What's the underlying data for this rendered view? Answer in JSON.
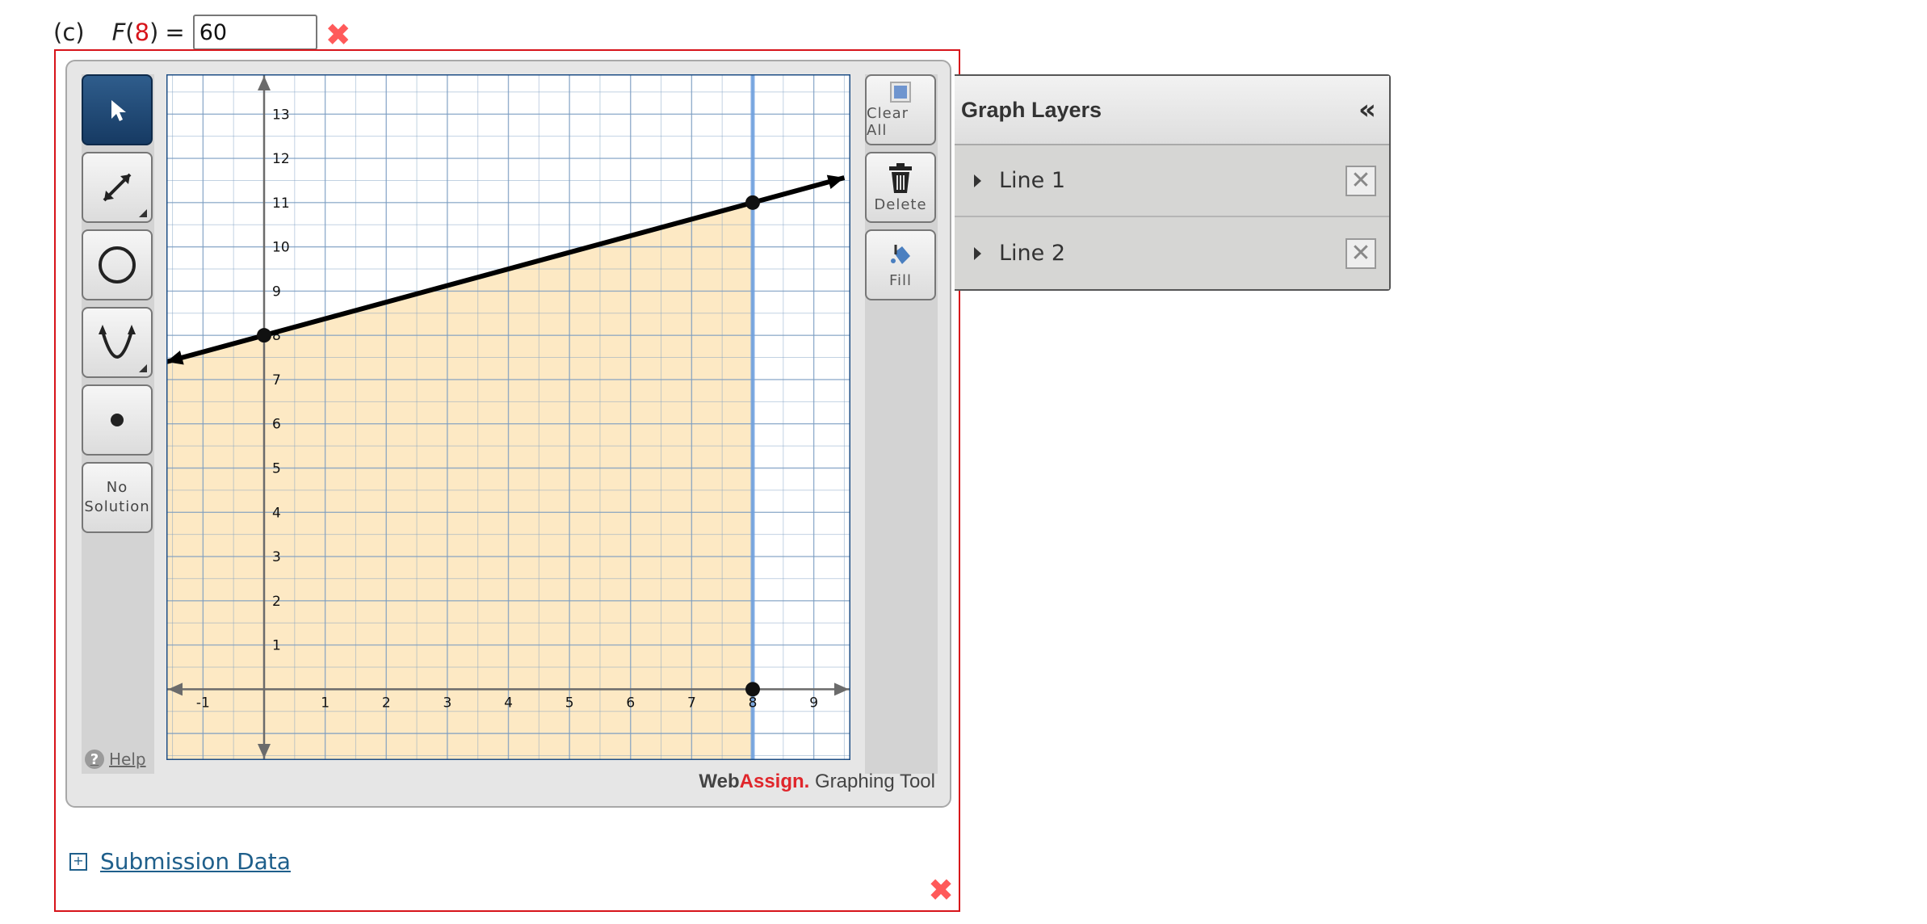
{
  "question": {
    "part_label": "(c)",
    "function_name": "F",
    "argument": "8",
    "equals": "=",
    "answer_value": "60",
    "incorrect_mark": "✖"
  },
  "tools": {
    "no_solution_line1": "No",
    "no_solution_line2": "Solution",
    "help_label": "Help",
    "help_icon": "?",
    "clear_all_label": "Clear All",
    "delete_label": "Delete",
    "fill_label": "Fill"
  },
  "brand": {
    "web": "Web",
    "assign": "Assign.",
    "rest": " Graphing Tool"
  },
  "layers": {
    "title": "Graph Layers",
    "collapse_icon": "«",
    "items": [
      {
        "label": "Line 1",
        "delete_icon": "✕"
      },
      {
        "label": "Line 2",
        "delete_icon": "✕"
      }
    ]
  },
  "submission": {
    "toggle": "+",
    "label": "Submission Data"
  },
  "frame_mark": "✖",
  "chart_data": {
    "type": "line",
    "x_ticks": [
      -1,
      1,
      2,
      3,
      4,
      5,
      6,
      7,
      8,
      9
    ],
    "y_ticks": [
      1,
      2,
      3,
      4,
      5,
      6,
      7,
      8,
      9,
      10,
      11,
      12,
      13
    ],
    "xlim": [
      -1.6,
      9.6
    ],
    "ylim": [
      -1.6,
      13.9
    ],
    "grid": true,
    "series": [
      {
        "kind": "line",
        "points": [
          [
            0,
            8
          ],
          [
            8,
            11
          ]
        ],
        "color": "#000000"
      },
      {
        "kind": "vertical-line",
        "x": 8,
        "points": [
          [
            8,
            0
          ],
          [
            8,
            11
          ]
        ],
        "color": "#6fa0e0"
      }
    ],
    "fill": {
      "region": "below line 1, left of x = 8",
      "color": "#fde9c4"
    },
    "colors": {
      "grid": "#7a9cc1",
      "axis": "#6b6b6b",
      "fill": "#fde9c4"
    }
  }
}
